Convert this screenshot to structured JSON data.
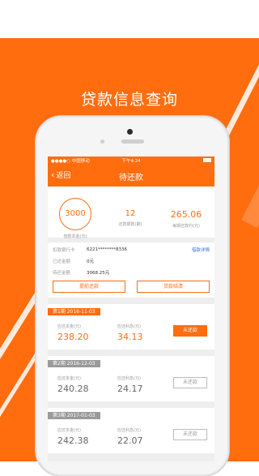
{
  "promo": {
    "title": "贷款信息查询",
    "background": "#ff6d0f"
  },
  "statusbar": {
    "carrier": "●●●●○ 中国移动",
    "time": "下午4:24",
    "battery": "100%"
  },
  "navbar": {
    "back_label": "返回",
    "title": "待还款"
  },
  "summary": {
    "principal_value": "3000",
    "principal_label": "借款本金(元)",
    "periods_value": "12",
    "periods_label": "还款期数(期)",
    "monthly_value": "265.06",
    "monthly_label": "每期还款约(元)"
  },
  "info": {
    "card_label": "扣款银行卡",
    "card_value": "6221********8336",
    "detail_link": "借款详情",
    "repaid_label": "已还金额",
    "repaid_value": "0元",
    "pending_label": "待还金额",
    "pending_value": "3068.25元",
    "early_btn": "提前还款",
    "settle_btn": "贷款结清"
  },
  "periods": [
    {
      "label": "第1期   2016-11-03",
      "principal_label": "应还本金(元)",
      "principal": "238.20",
      "interest_label": "应还利息(元)",
      "interest": "34.13",
      "status": "未还款",
      "active": true
    },
    {
      "label": "第2期   2016-12-03",
      "principal_label": "应还本金(元)",
      "principal": "240.28",
      "interest_label": "应还利息(元)",
      "interest": "24.17",
      "status": "未还款",
      "active": false
    },
    {
      "label": "第3期   2017-01-03",
      "principal_label": "应还本金(元)",
      "principal": "242.38",
      "interest_label": "应还利息(元)",
      "interest": "22.07",
      "status": "未还款",
      "active": false
    }
  ],
  "colors": {
    "accent": "#ff6d0f",
    "link": "#2f6fd6",
    "muted": "#9a9a9a"
  }
}
